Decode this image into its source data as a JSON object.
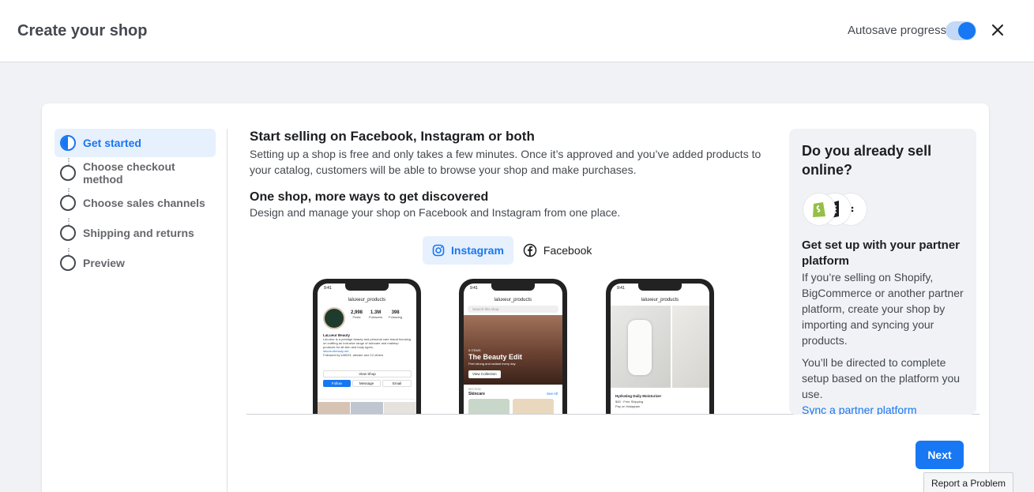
{
  "header": {
    "title": "Create your shop",
    "autosave_label": "Autosave progress",
    "autosave_on": true
  },
  "steps": [
    {
      "label": "Get started",
      "active": true
    },
    {
      "label": "Choose checkout method",
      "active": false
    },
    {
      "label": "Choose sales channels",
      "active": false
    },
    {
      "label": "Shipping and returns",
      "active": false
    },
    {
      "label": "Preview",
      "active": false
    }
  ],
  "main": {
    "heading": "Start selling on Facebook, Instagram or both",
    "description": "Setting up a shop is free and only takes a few minutes. Once it’s approved and you’ve added products to your catalog, customers will be able to browse your shop and make purchases.",
    "subheading": "One shop, more ways to get discovered",
    "subdescription": "Design and manage your shop on Facebook and Instagram from one place.",
    "tabs": [
      {
        "label": "Instagram",
        "icon": "instagram-icon",
        "active": true
      },
      {
        "label": "Facebook",
        "icon": "facebook-icon",
        "active": false
      }
    ],
    "phones": [
      {
        "time": "9:41",
        "handle": "laluxeur_products",
        "stats": [
          {
            "value": "2,998",
            "label": "Posts"
          },
          {
            "value": "1.3M",
            "label": "Followers"
          },
          {
            "value": "398",
            "label": "Following"
          }
        ],
        "brand": "LaLueur Beauty",
        "bio": "LaLueur is a prestige beauty and personal care brand focusing on crafting an inclusive range of skincare and makeup products for all skin and body types.",
        "url": "laluxeurbeauty.net",
        "followed_by": "Followed by lofti223, alexanr and 12 others",
        "view_shop": "View Shop",
        "buttons": [
          "Follow",
          "Message",
          "Email"
        ]
      },
      {
        "time": "9:41",
        "handle": "laluxeur_products",
        "search_placeholder": "Search this shop",
        "hero_kicker": "5 ITEMS",
        "hero_title": "The Beauty Edit",
        "hero_sub": "Feel strong and radiant every day",
        "hero_button": "View Collection",
        "section_kicker": "SECTION",
        "section_title": "Skincare",
        "see_all": "See All"
      },
      {
        "time": "9:41",
        "handle": "laluxeur_products",
        "product_name": "Hydrating Daily Moisturizer",
        "price": "$45 · Free Shipping",
        "pay_note": "Pay on Instagram"
      }
    ]
  },
  "side": {
    "question": "Do you already sell online?",
    "partner_heading": "Get set up with your partner platform",
    "partner_text": "If you’re selling on Shopify, BigCommerce or another partner platform, create your shop by importing and syncing your products.",
    "directed_text": "You’ll be directed to complete setup based on the platform you use.",
    "link": "Sync a partner platform"
  },
  "actions": {
    "next": "Next",
    "report": "Report a Problem"
  },
  "colors": {
    "accent": "#1877f2",
    "accent_light": "#e7f0fd",
    "shopify_green": "#95bf47"
  }
}
